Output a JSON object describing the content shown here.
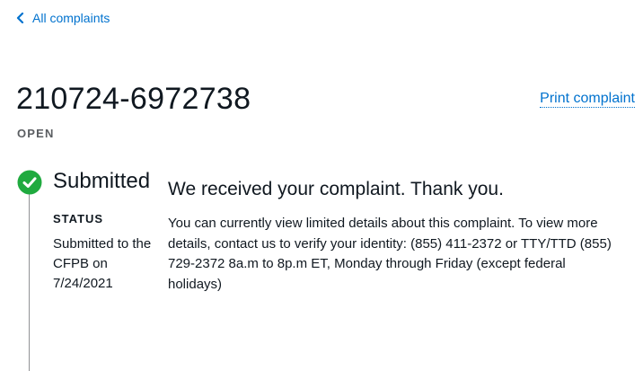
{
  "nav": {
    "back_label": "All complaints"
  },
  "complaint": {
    "id": "210724-6972738",
    "state": "OPEN",
    "print_label": "Print complaint"
  },
  "timeline": {
    "step_title": "Submitted",
    "status_label": "STATUS",
    "status_detail": "Submitted to the CFPB on 7/24/2021"
  },
  "message": {
    "title": "We received your complaint. Thank you.",
    "body": "You can currently view limited details about this complaint. To view more details, contact us to verify your identity: (855) 411-2372 or TTY/TTD (855) 729-2372 8a.m to 8p.m ET, Monday through Friday (except federal holidays)"
  },
  "colors": {
    "link": "#0072ce",
    "success": "#20aa3f",
    "text": "#101820",
    "muted": "#5a5d61"
  },
  "icons": {
    "back": "chevron-left-icon",
    "status": "check-circle-icon"
  }
}
